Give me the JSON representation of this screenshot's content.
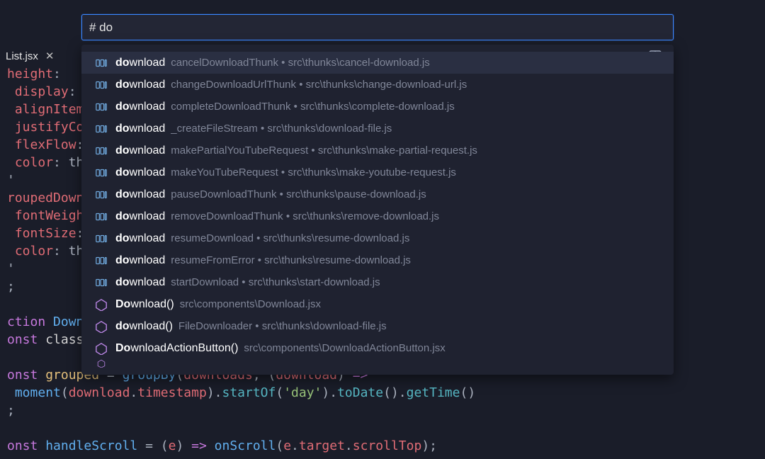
{
  "tab": {
    "filename": "List.jsx"
  },
  "palette": {
    "value": "# do"
  },
  "code": {
    "l1a": "height",
    "l1b": ":",
    "l2a": "display",
    "l2b": ":",
    "l3a": "alignItem",
    "l4a": "justifyCo",
    "l5a": "flexFlow",
    "l5b": ":",
    "l6a": "color",
    "l6b": ": th",
    "l7": "'",
    "l8": "roupedDown",
    "l9a": "fontWeigh",
    "l10a": "fontSize",
    "l10b": ":",
    "l11a": "color",
    "l11b": ": th",
    "l12": "'",
    "l13": ";",
    "lblank": "",
    "l14a": "ction ",
    "l14b": "Down",
    "l15a": "onst ",
    "l15b": "class",
    "l17a": "onst ",
    "l17b": "grouped",
    "l17c": " = ",
    "l17d": "groupBy",
    "l17e": "(",
    "l17f": "downloads",
    "l17g": ", (",
    "l17h": "download",
    "l17i": ") ",
    "l17j": "=>",
    "l18a": "moment",
    "l18b": "(",
    "l18c": "download",
    "l18d": ".",
    "l18e": "timestamp",
    "l18f": ").",
    "l18g": "startOf",
    "l18h": "(",
    "l18i": "'day'",
    "l18j": ").",
    "l18k": "toDate",
    "l18l": "().",
    "l18m": "getTime",
    "l18n": "()",
    "l19": ";",
    "l21a": "onst ",
    "l21b": "handleScroll",
    "l21c": " = (",
    "l21d": "e",
    "l21e": ") ",
    "l21f": "=>",
    "l21g": " ",
    "l21h": "onScroll",
    "l21i": "(",
    "l21j": "e",
    "l21k": ".",
    "l21l": "target",
    "l21m": ".",
    "l21n": "scrollTop",
    "l21o": ");"
  },
  "suggestions": [
    {
      "icon": "method",
      "bold": "do",
      "rest": "wnload",
      "suffix": "",
      "detail": "cancelDownloadThunk • src\\thunks\\cancel-download.js"
    },
    {
      "icon": "method",
      "bold": "do",
      "rest": "wnload",
      "suffix": "",
      "detail": "changeDownloadUrlThunk • src\\thunks\\change-download-url.js"
    },
    {
      "icon": "method",
      "bold": "do",
      "rest": "wnload",
      "suffix": "",
      "detail": "completeDownloadThunk • src\\thunks\\complete-download.js"
    },
    {
      "icon": "method",
      "bold": "do",
      "rest": "wnload",
      "suffix": "",
      "detail": "_createFileStream • src\\thunks\\download-file.js"
    },
    {
      "icon": "method",
      "bold": "do",
      "rest": "wnload",
      "suffix": "",
      "detail": "makePartialYouTubeRequest • src\\thunks\\make-partial-request.js"
    },
    {
      "icon": "method",
      "bold": "do",
      "rest": "wnload",
      "suffix": "",
      "detail": "makeYouTubeRequest • src\\thunks\\make-youtube-request.js"
    },
    {
      "icon": "method",
      "bold": "do",
      "rest": "wnload",
      "suffix": "",
      "detail": "pauseDownloadThunk • src\\thunks\\pause-download.js"
    },
    {
      "icon": "method",
      "bold": "do",
      "rest": "wnload",
      "suffix": "",
      "detail": "removeDownloadThunk • src\\thunks\\remove-download.js"
    },
    {
      "icon": "method",
      "bold": "do",
      "rest": "wnload",
      "suffix": "",
      "detail": "resumeDownload • src\\thunks\\resume-download.js"
    },
    {
      "icon": "method",
      "bold": "do",
      "rest": "wnload",
      "suffix": "",
      "detail": "resumeFromError • src\\thunks\\resume-download.js"
    },
    {
      "icon": "method",
      "bold": "do",
      "rest": "wnload",
      "suffix": "",
      "detail": "startDownload • src\\thunks\\start-download.js"
    },
    {
      "icon": "class",
      "bold": "Do",
      "rest": "wnload",
      "suffix": "()",
      "detail": "src\\components\\Download.jsx"
    },
    {
      "icon": "class",
      "bold": "do",
      "rest": "wnload",
      "suffix": "()",
      "detail": "FileDownloader • src\\thunks\\download-file.js"
    },
    {
      "icon": "class",
      "bold": "Do",
      "rest": "wnloadActionButton",
      "suffix": "()",
      "detail": "src\\components\\DownloadActionButton.jsx"
    }
  ]
}
